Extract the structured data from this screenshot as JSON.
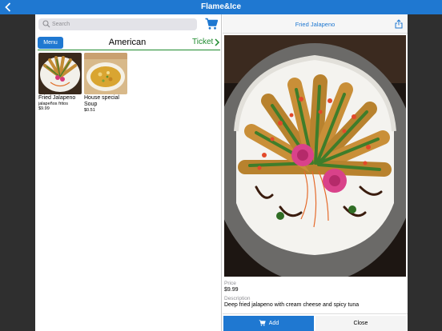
{
  "app": {
    "title": "Flame&Ice"
  },
  "search": {
    "placeholder": "Search"
  },
  "menu": {
    "menu_button": "Menu",
    "category": "American",
    "ticket_button": "Ticket",
    "items": [
      {
        "name": "Fried Jalapeno",
        "subtitle": "jalapeños fritos",
        "price": "$9.99"
      },
      {
        "name": "House special Soup",
        "subtitle": "",
        "price": "$0.51"
      }
    ]
  },
  "detail": {
    "title": "Fried Jalapeno",
    "price_label": "Price",
    "price": "$9.99",
    "description_label": "Description",
    "description": "Deep fried jalapeno with cream cheese and spicy tuna",
    "add_button": "Add",
    "close_button": "Close"
  },
  "colors": {
    "accent": "#1f78d1",
    "ticket": "#1e8a2e",
    "dim": "#2f2f2f"
  },
  "icons": [
    "back-chevron-icon",
    "search-icon",
    "cart-icon",
    "chevron-right-icon",
    "share-icon"
  ]
}
